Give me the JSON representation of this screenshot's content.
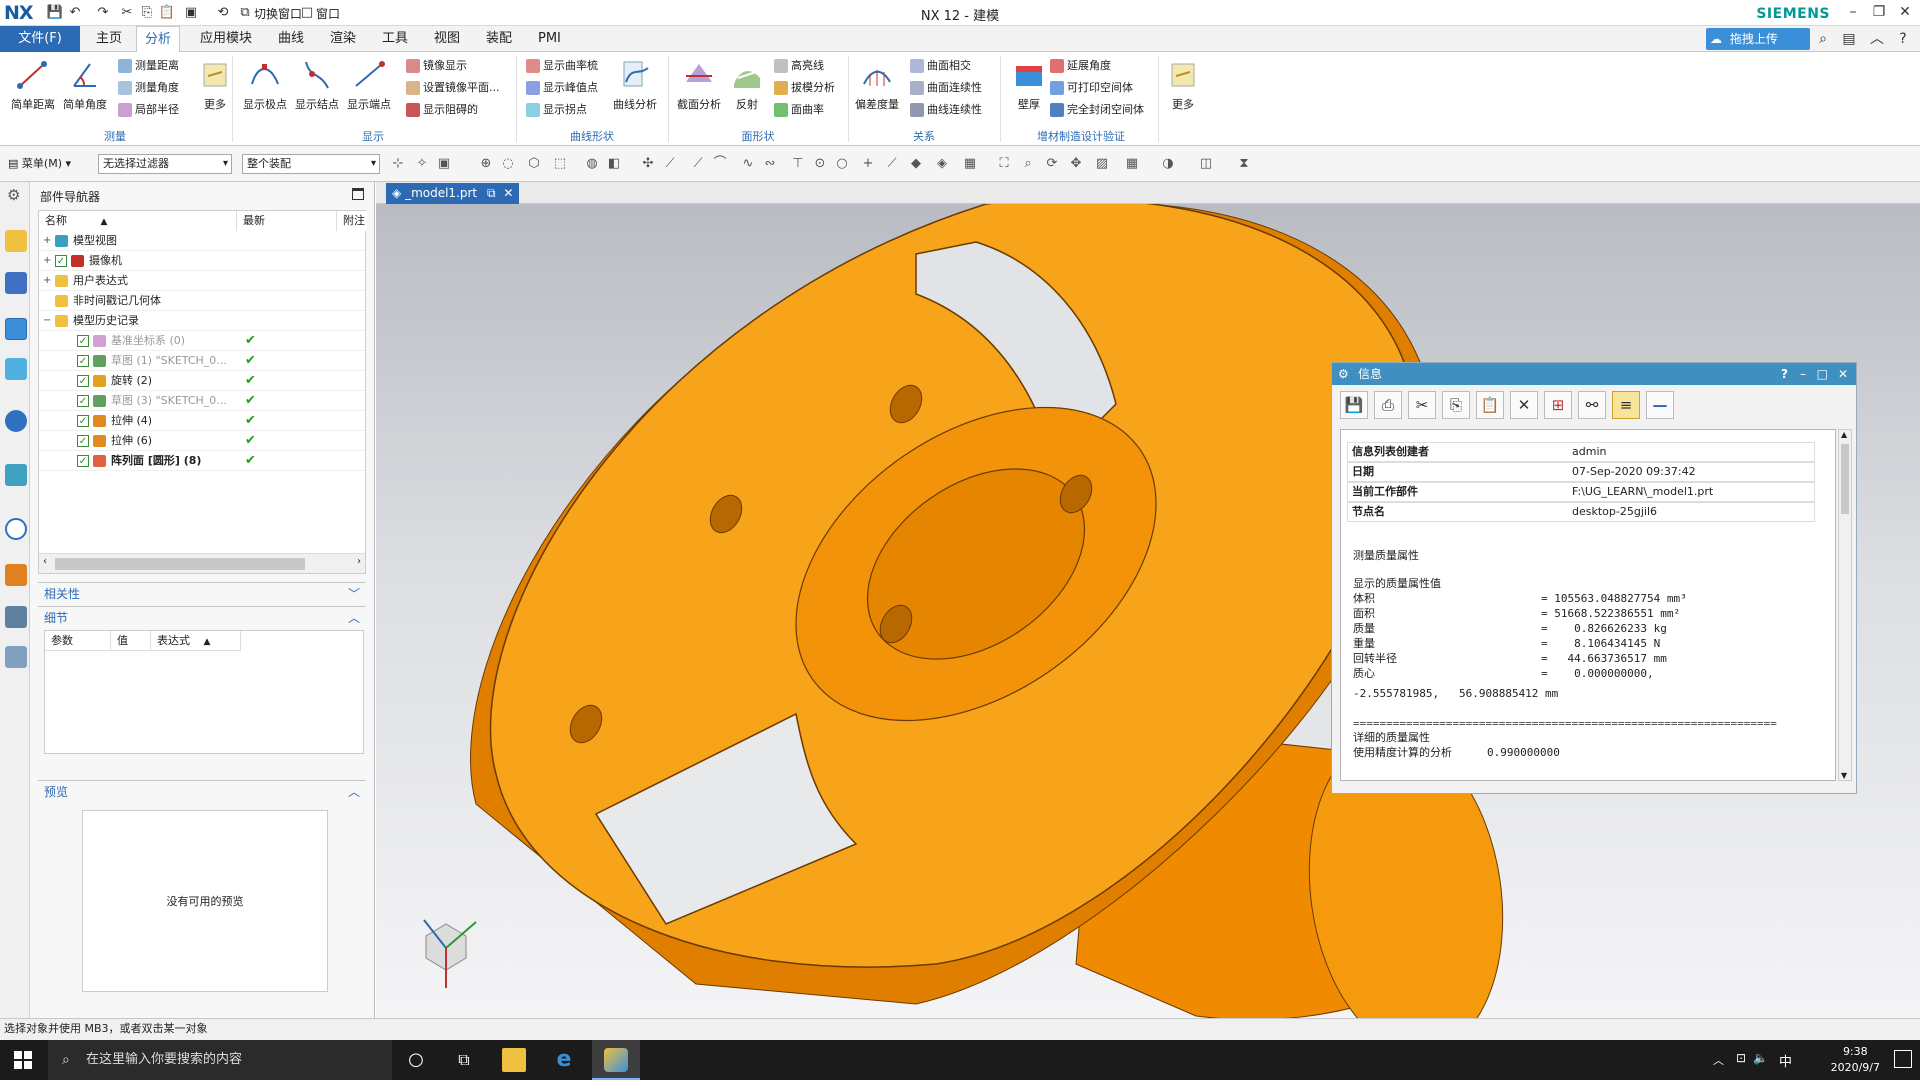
{
  "titlebar": {
    "logo": "NX",
    "switch_window": "切换窗口",
    "window_menu": "窗口",
    "title": "NX 12 - 建模",
    "brand": "SIEMENS"
  },
  "menubar": {
    "file": "文件(F)",
    "tabs": [
      "主页",
      "分析",
      "应用模块",
      "曲线",
      "渲染",
      "工具",
      "视图",
      "装配",
      "PMI"
    ],
    "active_tab": "分析",
    "cloud_button": "拖拽上传"
  },
  "ribbon": {
    "measure": {
      "label": "测量",
      "simple_distance": "简单距离",
      "simple_angle": "简单角度",
      "measure_distance": "测量距离",
      "measure_angle": "测量角度",
      "local_radius": "局部半径",
      "more": "更多"
    },
    "display": {
      "label": "显示",
      "show_poles": "显示极点",
      "show_knots": "显示结点",
      "show_ends": "显示端点",
      "mirror_display": "镜像显示",
      "set_mirror_plane": "设置镜像平面...",
      "show_hidden": "显示阻碍的"
    },
    "curve_shape": {
      "label": "曲线形状",
      "show_curvature_comb": "显示曲率梳",
      "show_peak": "显示峰值点",
      "show_inflection": "显示拐点",
      "curve_analysis": "曲线分析"
    },
    "face_shape": {
      "label": "面形状",
      "section_analysis": "截面分析",
      "reflection": "反射",
      "highlight": "高亮线",
      "draft_analysis": "拔模分析",
      "face_curvature": "面曲率"
    },
    "relation": {
      "label": "关系",
      "deviation_gauge": "偏差度量",
      "face_intersection": "曲面相交",
      "face_continuity": "曲面连续性",
      "curve_continuity": "曲线连续性"
    },
    "am": {
      "label": "增材制造设计验证",
      "wall_thickness": "壁厚",
      "overhang_angle": "延展角度",
      "printable_void": "可打印空间体",
      "fully_enclosed_void": "完全封闭空间体"
    },
    "more": "更多"
  },
  "toolbar2": {
    "menu": "菜单(M)",
    "filter": "无选择过滤器",
    "scope": "整个装配"
  },
  "navigator": {
    "title": "部件导航器",
    "columns": [
      "名称",
      "最新",
      "附注"
    ],
    "rows": [
      {
        "label": "模型视图",
        "level": 0
      },
      {
        "label": "摄像机",
        "level": 0
      },
      {
        "label": "用户表达式",
        "level": 0
      },
      {
        "label": "非时间戳记几何体",
        "level": 0
      },
      {
        "label": "模型历史记录",
        "level": 0
      },
      {
        "label": "基准坐标系 (0)",
        "level": 1
      },
      {
        "label": "草图 (1) \"SKETCH_0...",
        "level": 1
      },
      {
        "label": "旋转 (2)",
        "level": 1
      },
      {
        "label": "草图 (3) \"SKETCH_0...",
        "level": 1
      },
      {
        "label": "拉伸 (4)",
        "level": 1
      },
      {
        "label": "拉伸 (6)",
        "level": 1
      },
      {
        "label": "阵列面 [圆形] (8)",
        "level": 1
      }
    ],
    "dependencies": "相关性",
    "details": "细节",
    "details_columns": [
      "参数",
      "值",
      "表达式"
    ],
    "preview": "预览",
    "preview_empty": "没有可用的预览"
  },
  "viewport": {
    "tab": "_model1.prt",
    "part_color": "#f59a0c"
  },
  "info": {
    "title": "信息",
    "header": [
      {
        "k": "信息列表创建者",
        "v": "admin"
      },
      {
        "k": "日期",
        "v": "07-Sep-2020 09:37:42"
      },
      {
        "k": "当前工作部件",
        "v": "F:\\UG_LEARN\\_model1.prt"
      },
      {
        "k": "节点名",
        "v": "desktop-25gjil6"
      }
    ],
    "section": "测量质量属性",
    "subsection": "显示的质量属性值",
    "props": [
      {
        "k": "体积",
        "v": "= 105563.048827754 mm³"
      },
      {
        "k": "面积",
        "v": "= 51668.522386551 mm²"
      },
      {
        "k": "质量",
        "v": "=    0.826626233 kg"
      },
      {
        "k": "重量",
        "v": "=    8.106434145 N"
      },
      {
        "k": "回转半径",
        "v": "=   44.663736517 mm"
      },
      {
        "k": "质心",
        "v": "=    0.000000000,"
      }
    ],
    "centroid_line": "-2.555781985,   56.908885412 mm",
    "separator": "================================================================",
    "detail_title": "详细的质量属性",
    "precision_label": "使用精度计算的分析",
    "precision_value": "0.990000000"
  },
  "statusbar": {
    "text": "选择对象并使用 MB3，或者双击某一对象"
  },
  "taskbar": {
    "search": "在这里输入你要搜索的内容",
    "time": "9:38",
    "date": "2020/9/7",
    "ime": "中"
  }
}
